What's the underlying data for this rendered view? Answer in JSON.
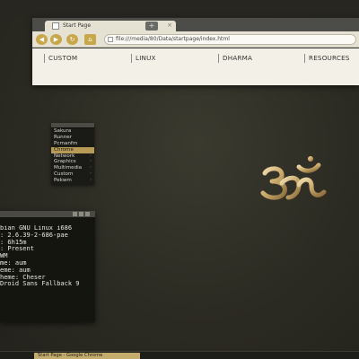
{
  "browser": {
    "tab_title": "Start Page",
    "tab_close": "×",
    "new_tab": "+",
    "url": "file:///media/80/Data/startpage/index.html",
    "page_links": [
      "CUSTOM",
      "LINUX",
      "DHARMA",
      "RESOURCES"
    ]
  },
  "menu": {
    "items": [
      {
        "label": "Sakura",
        "submenu": false,
        "active": false
      },
      {
        "label": "Runner",
        "submenu": false,
        "active": false
      },
      {
        "label": "Pcmanfm",
        "submenu": false,
        "active": false
      },
      {
        "label": "Chrome",
        "submenu": false,
        "active": true
      },
      {
        "label": "Network",
        "submenu": true,
        "active": false
      },
      {
        "label": "Graphics",
        "submenu": true,
        "active": false
      },
      {
        "label": "Multimedia",
        "submenu": true,
        "active": false
      },
      {
        "label": "Custom",
        "submenu": true,
        "active": false
      },
      {
        "label": "Pekwm",
        "submenu": true,
        "active": false
      }
    ],
    "arrow": "›"
  },
  "terminal": {
    "lines": [
      "bian GNU Linux i686",
      ": 2.6.39-2-686-pae",
      ": 6h15m",
      ": Present",
      "WM",
      "me: aum",
      "eme: aum",
      "heme: Cheser",
      "Droid Sans Fallback 9"
    ]
  },
  "taskbar": {
    "task_label": "Start Page - Google Chrome"
  },
  "colors": {
    "desktop": "#2e2d25",
    "accent_gold": "#c4ad6c",
    "page_bg": "#f3f1e7"
  }
}
